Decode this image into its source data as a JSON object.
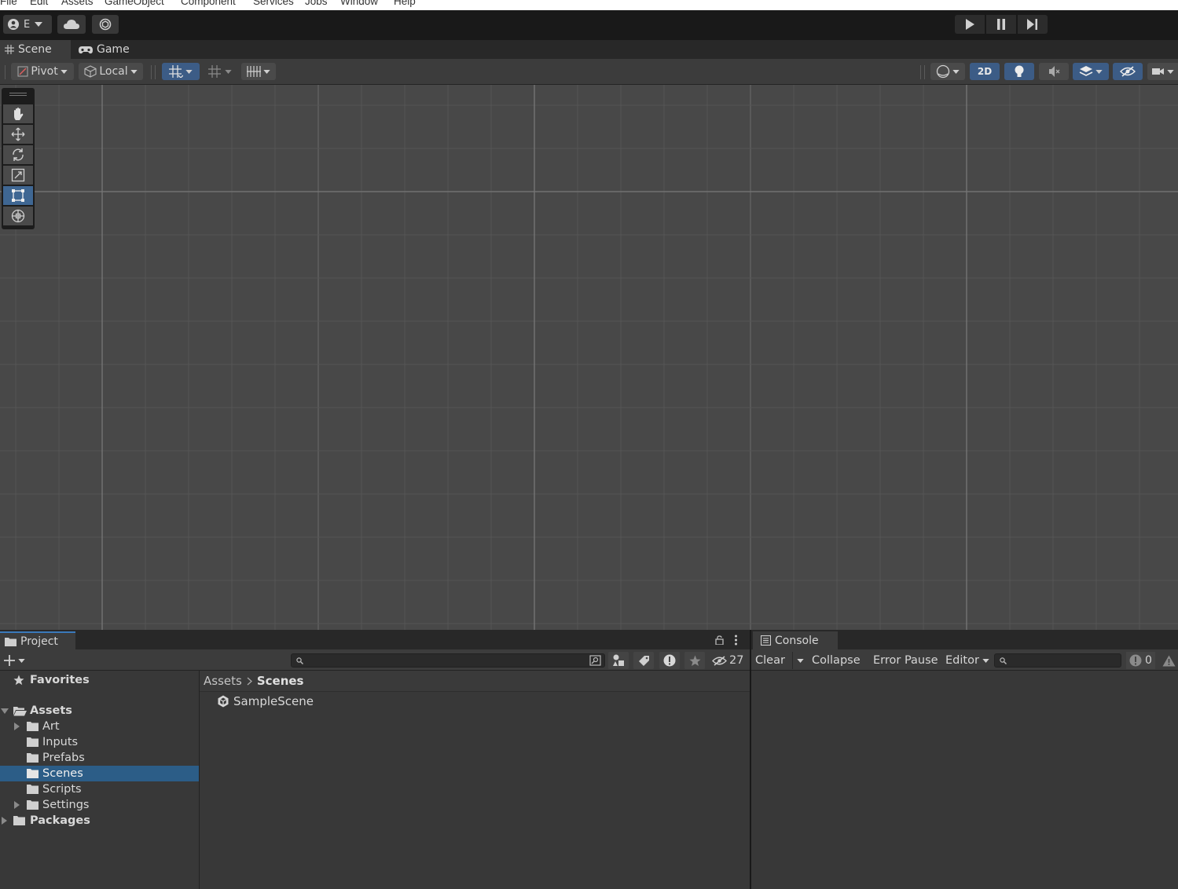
{
  "menu": {
    "items": [
      "File",
      "Edit",
      "Assets",
      "GameObject",
      "Component",
      "Services",
      "Jobs",
      "Window",
      "Help"
    ]
  },
  "toolbar": {
    "account_label": "E",
    "account_icon": "account-icon",
    "cloud_icon": "cloud-icon",
    "collab_icon": "collab-icon",
    "play_icon": "play-icon",
    "pause_icon": "pause-icon",
    "step_icon": "step-icon"
  },
  "view_tabs": {
    "scene_label": "Scene",
    "game_label": "Game"
  },
  "scene_toolbar": {
    "pivot_label": "Pivot",
    "local_label": "Local",
    "mode_2d_label": "2D"
  },
  "tools": [
    "hand-tool",
    "move-tool",
    "rotate-tool",
    "scale-tool",
    "rect-tool",
    "transform-tool"
  ],
  "selected_tool": "rect-tool",
  "project": {
    "tab_label": "Project",
    "hidden_count": "27",
    "tree": {
      "favorites_label": "Favorites",
      "assets_label": "Assets",
      "children": [
        {
          "label": "Art",
          "expandable": true
        },
        {
          "label": "Inputs",
          "expandable": false
        },
        {
          "label": "Prefabs",
          "expandable": false
        },
        {
          "label": "Scenes",
          "expandable": false,
          "selected": true
        },
        {
          "label": "Scripts",
          "expandable": false
        },
        {
          "label": "Settings",
          "expandable": true
        }
      ],
      "packages_label": "Packages"
    },
    "breadcrumb": {
      "root": "Assets",
      "current": "Scenes"
    },
    "files": [
      {
        "label": "SampleScene",
        "icon": "unity-scene-icon"
      }
    ]
  },
  "console": {
    "tab_label": "Console",
    "clear_label": "Clear",
    "collapse_label": "Collapse",
    "error_pause_label": "Error Pause",
    "editor_label": "Editor",
    "error_count": "0"
  },
  "colors": {
    "selection_blue": "#2c5d87",
    "active_tab_accent": "#3a79bb",
    "toolbar_blue": "#3c5c86"
  }
}
